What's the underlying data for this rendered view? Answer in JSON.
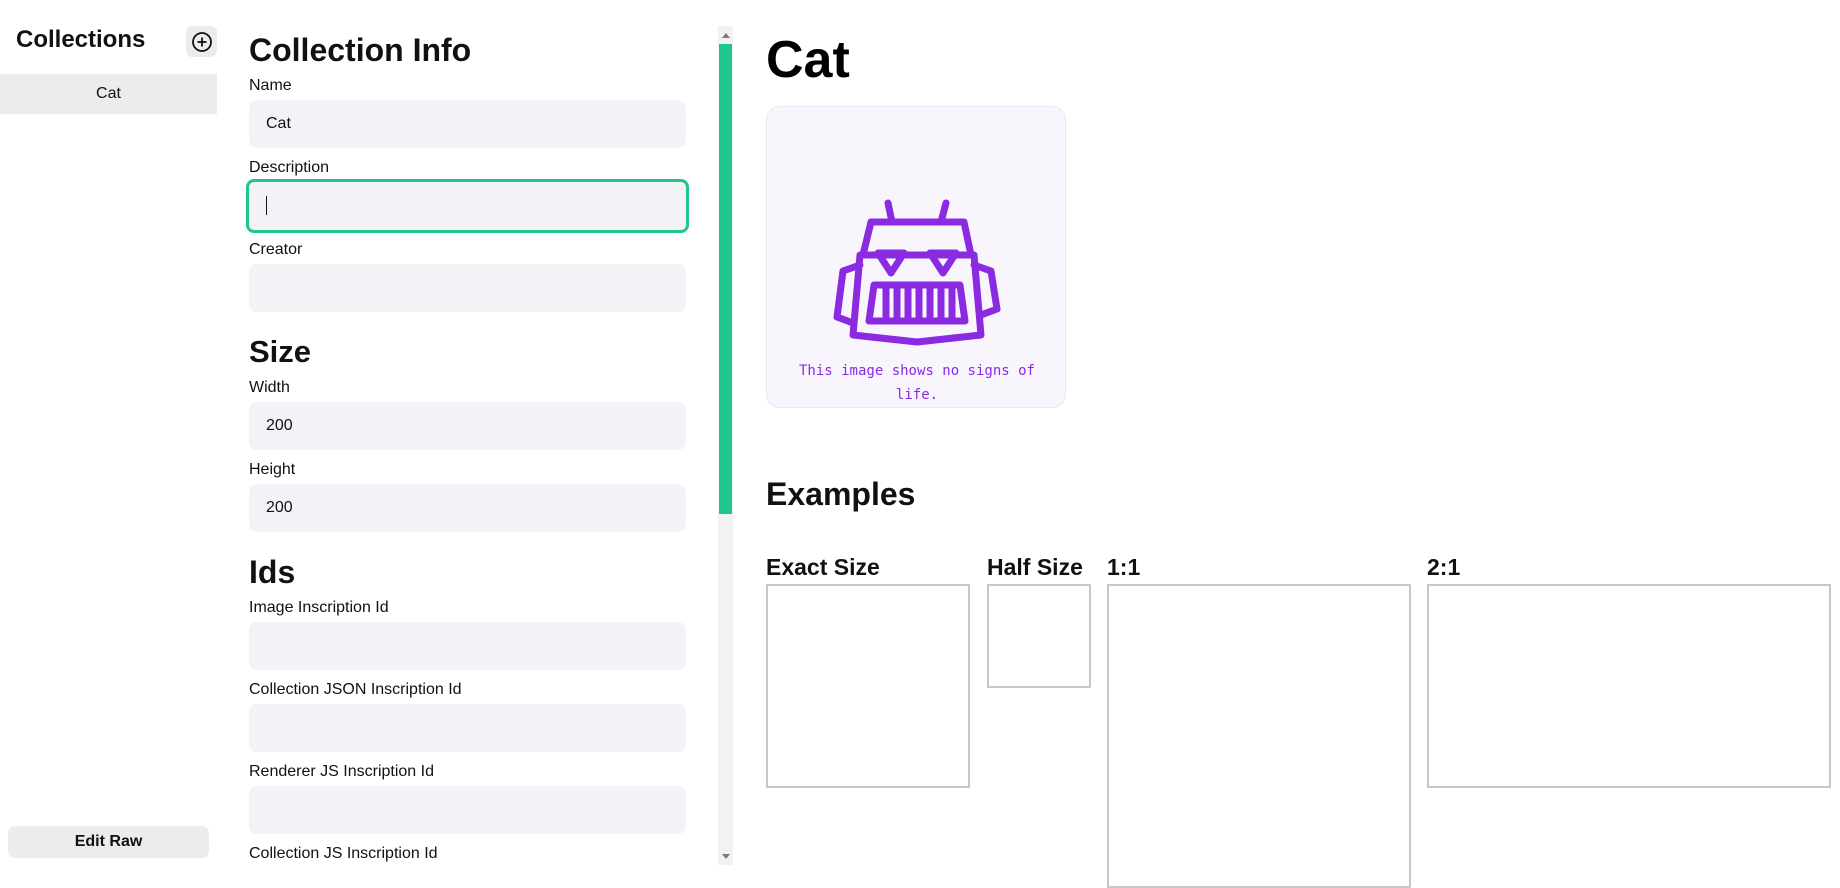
{
  "sidebar": {
    "title": "Collections",
    "add_icon": "plus-circle-icon",
    "items": [
      {
        "label": "Cat"
      }
    ],
    "edit_raw_label": "Edit Raw"
  },
  "form": {
    "collection_info_heading": "Collection Info",
    "name_label": "Name",
    "name_value": "Cat",
    "description_label": "Description",
    "description_value": "",
    "creator_label": "Creator",
    "creator_value": "",
    "size_heading": "Size",
    "width_label": "Width",
    "width_value": "200",
    "height_label": "Height",
    "height_value": "200",
    "ids_heading": "Ids",
    "image_inscription_label": "Image Inscription Id",
    "image_inscription_value": "",
    "collection_json_label": "Collection JSON Inscription Id",
    "collection_json_value": "",
    "renderer_js_label": "Renderer JS Inscription Id",
    "renderer_js_value": "",
    "collection_js_label": "Collection JS Inscription Id"
  },
  "preview": {
    "title": "Cat",
    "image_icon": "robot-icon",
    "image_caption": "This image shows no signs of life.",
    "examples_heading": "Examples",
    "examples": [
      {
        "label": "Exact Size"
      },
      {
        "label": "Half Size"
      },
      {
        "label": "1:1"
      },
      {
        "label": "2:1"
      }
    ]
  },
  "colors": {
    "accent": "#21c58e",
    "robot": "#8a2be2",
    "input_bg": "#f2f3f6",
    "sidebar_item_bg": "#ececec"
  }
}
